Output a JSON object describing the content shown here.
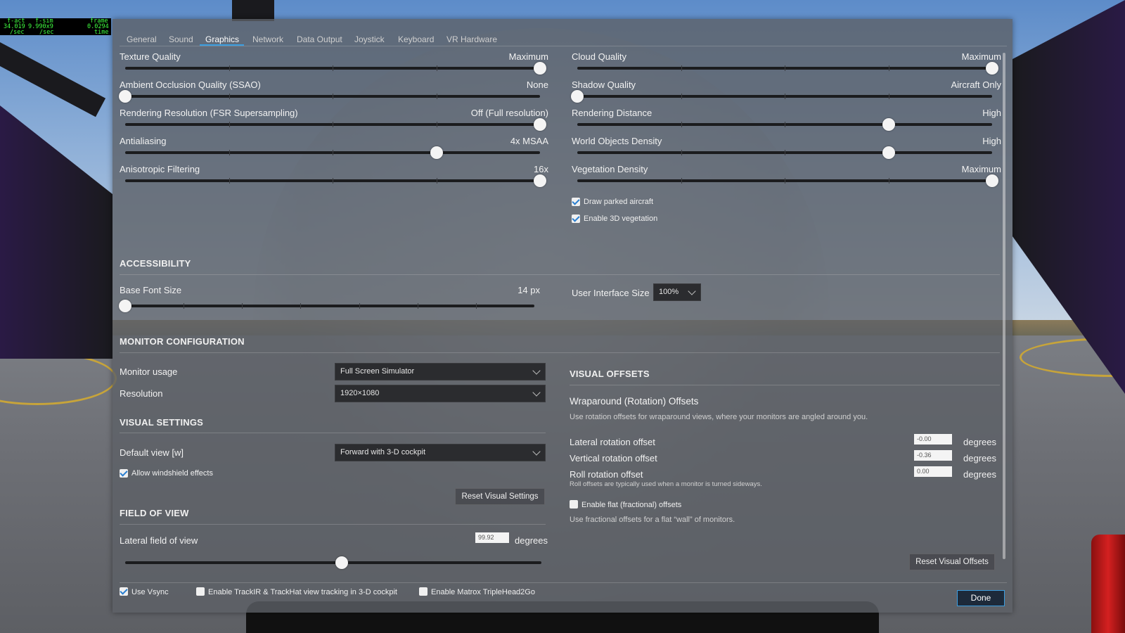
{
  "fps_overlay": {
    "col1": [
      "f-act",
      "34.019",
      "/sec"
    ],
    "col2": [
      "f-sim",
      "9.990x9",
      "/sec"
    ],
    "col3": [
      "frame",
      "0.0294",
      "time"
    ]
  },
  "tabs": [
    "General",
    "Sound",
    "Graphics",
    "Network",
    "Data Output",
    "Joystick",
    "Keyboard",
    "VR Hardware"
  ],
  "active_tab": "Graphics",
  "left_sliders": [
    {
      "label": "Texture Quality",
      "value": "Maximum",
      "level": 1.0
    },
    {
      "label": "Ambient Occlusion Quality (SSAO)",
      "value": "None",
      "level": 0.0
    },
    {
      "label": "Rendering Resolution (FSR Supersampling)",
      "value": "Off (Full resolution)",
      "level": 1.0
    },
    {
      "label": "Antialiasing",
      "value": "4x MSAA",
      "level": 0.75
    },
    {
      "label": "Anisotropic Filtering",
      "value": "16x",
      "level": 1.0
    }
  ],
  "right_sliders": [
    {
      "label": "Cloud Quality",
      "value": "Maximum",
      "level": 1.0
    },
    {
      "label": "Shadow Quality",
      "value": "Aircraft Only",
      "level": 0.0
    },
    {
      "label": "Rendering Distance",
      "value": "High",
      "level": 0.75
    },
    {
      "label": "World Objects Density",
      "value": "High",
      "level": 0.75
    },
    {
      "label": "Vegetation Density",
      "value": "Maximum",
      "level": 1.0
    }
  ],
  "graphics_checkboxes": [
    {
      "label": "Draw parked aircraft",
      "checked": true
    },
    {
      "label": "Enable 3D vegetation",
      "checked": true
    }
  ],
  "accessibility": {
    "title": "ACCESSIBILITY",
    "font_size_label": "Base Font Size",
    "font_size_value": "14 px",
    "font_size_level": 0.0,
    "ui_size_label": "User Interface Size",
    "ui_size_value": "100%"
  },
  "monitor": {
    "title": "MONITOR CONFIGURATION",
    "usage_label": "Monitor usage",
    "usage_value": "Full Screen Simulator",
    "resolution_label": "Resolution",
    "resolution_value": "1920×1080"
  },
  "visual_settings": {
    "title": "VISUAL SETTINGS",
    "default_view_label": "Default view [w]",
    "default_view_value": "Forward with 3-D cockpit",
    "windshield_label": "Allow windshield effects",
    "windshield_checked": true,
    "reset_button": "Reset Visual Settings"
  },
  "fov": {
    "title": "FIELD OF VIEW",
    "lateral_label": "Lateral field of view",
    "lateral_value": "99.92",
    "unit": "degrees",
    "level": 0.52
  },
  "visual_offsets": {
    "title": "VISUAL OFFSETS",
    "wrap_title": "Wraparound (Rotation) Offsets",
    "wrap_desc": "Use rotation offsets for wraparound views, where your monitors are angled around you.",
    "rows": [
      {
        "label": "Lateral rotation offset",
        "value": "-0.00",
        "unit": "degrees"
      },
      {
        "label": "Vertical rotation offset",
        "value": "-0.36",
        "unit": "degrees"
      },
      {
        "label": "Roll rotation offset",
        "value": "0.00",
        "unit": "degrees"
      }
    ],
    "roll_note": "Roll offsets are typically used when a monitor is turned sideways.",
    "flat_label": "Enable flat (fractional) offsets",
    "flat_checked": false,
    "flat_desc": "Use fractional offsets for a flat “wall” of monitors.",
    "reset_button": "Reset Visual Offsets"
  },
  "footer": {
    "vsync_label": "Use Vsync",
    "vsync_checked": true,
    "trackir_label": "Enable TrackIR & TrackHat view tracking in 3-D cockpit",
    "trackir_checked": false,
    "matrox_label": "Enable Matrox TripleHead2Go",
    "matrox_checked": false,
    "done_button": "Done"
  }
}
